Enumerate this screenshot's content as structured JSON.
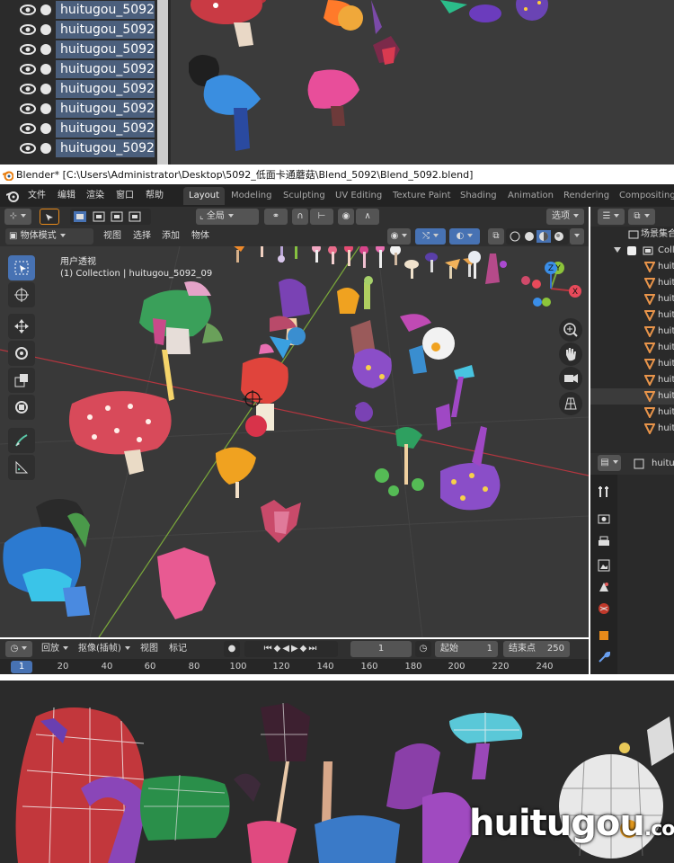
{
  "top_outliner": {
    "items": [
      "huitugou_5092",
      "huitugou_5092",
      "huitugou_5092",
      "huitugou_5092",
      "huitugou_5092",
      "huitugou_5092",
      "huitugou_5092",
      "huitugou_5092"
    ]
  },
  "window": {
    "title": "Blender* [C:\\Users\\Administrator\\Desktop\\5092_低面卡通蘑菇\\Blend_5092\\Blend_5092.blend]"
  },
  "menubar": {
    "file": "文件",
    "edit": "编辑",
    "render": "渲染",
    "window": "窗口",
    "help": "帮助"
  },
  "workspaces": {
    "tabs": [
      "Layout",
      "Modeling",
      "Sculpting",
      "UV Editing",
      "Texture Paint",
      "Shading",
      "Animation",
      "Rendering",
      "Compositing"
    ],
    "active": "Layout"
  },
  "viewport_header": {
    "transform_orientation": "全局",
    "options": "选项",
    "mode": "物体模式",
    "menus": [
      "视图",
      "选择",
      "添加",
      "物体"
    ]
  },
  "viewport": {
    "view_name": "用户透视",
    "active_object": "(1) Collection | huitugou_5092_09",
    "gizmo": {
      "z": "Z",
      "y": "Y",
      "x": "X"
    },
    "colors": {
      "background": "#393939",
      "x_axis": "#b3363f",
      "y_axis": "#7aa83a",
      "active_tool": "#4772b3"
    }
  },
  "right_panel": {
    "title": "场景集合",
    "collection": "Coll",
    "items": [
      "huit",
      "huit",
      "huit",
      "huit",
      "huit",
      "huit",
      "huit",
      "huit",
      "huit",
      "huit",
      "huit"
    ],
    "properties_object": "huitu"
  },
  "timeline": {
    "playback": "回放",
    "keying": "抠像(插帧)",
    "view": "视图",
    "marker": "标记",
    "current_frame": "1",
    "start_label": "起始",
    "start": "1",
    "end_label": "结束点",
    "end": "250",
    "badge": "1",
    "ticks": [
      "20",
      "40",
      "60",
      "80",
      "100",
      "120",
      "140",
      "160",
      "180",
      "200",
      "220",
      "240"
    ]
  },
  "watermark": {
    "main": "huitugou",
    "suffix": ".com"
  }
}
